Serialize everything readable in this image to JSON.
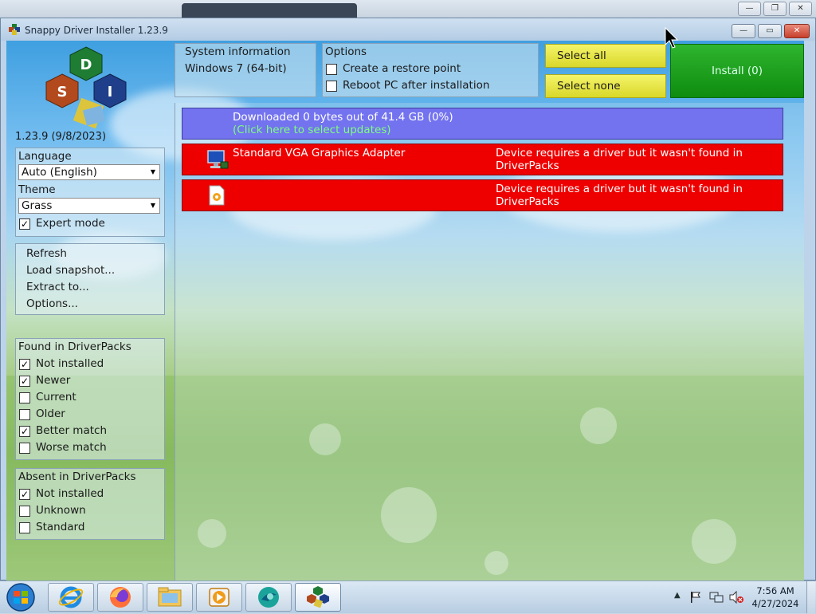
{
  "window": {
    "title": "Snappy Driver Installer 1.23.9",
    "controls": [
      "—",
      "▭",
      "✕"
    ]
  },
  "logo": {
    "letters": [
      "D",
      "S",
      "I"
    ],
    "version": "1.23.9 (9/8/2023)"
  },
  "sidebar": {
    "language_label": "Language",
    "language_value": "Auto (English)",
    "theme_label": "Theme",
    "theme_value": "Grass",
    "expert_mode_label": "Expert mode",
    "expert_mode_checked": true,
    "menu": [
      "Refresh",
      "Load snapshot...",
      "Extract to...",
      "Options..."
    ],
    "found_group": {
      "title": "Found in DriverPacks",
      "items": [
        {
          "label": "Not installed",
          "checked": true
        },
        {
          "label": "Newer",
          "checked": true
        },
        {
          "label": "Current",
          "checked": false
        },
        {
          "label": "Older",
          "checked": false
        },
        {
          "label": "Better match",
          "checked": true
        },
        {
          "label": "Worse match",
          "checked": false
        }
      ]
    },
    "absent_group": {
      "title": "Absent in DriverPacks",
      "items": [
        {
          "label": "Not installed",
          "checked": true
        },
        {
          "label": "Unknown",
          "checked": false
        },
        {
          "label": "Standard",
          "checked": false
        }
      ]
    }
  },
  "system_info": {
    "title": "System information",
    "os": "Windows 7 (64-bit)"
  },
  "options": {
    "title": "Options",
    "restore_point": "Create a restore point",
    "reboot": "Reboot PC after installation"
  },
  "buttons": {
    "select_all": "Select all",
    "select_none": "Select none",
    "install": "Install (0)"
  },
  "list": {
    "download": {
      "line1": "Downloaded 0 bytes out of 41.4 GB (0%)",
      "line2": "(Click here to select updates)"
    },
    "devices": [
      {
        "name": "Standard VGA Graphics Adapter",
        "status": "Device requires a driver but it wasn't found in DriverPacks",
        "icon": "monitor-icon"
      },
      {
        "name": "",
        "status": "Device requires a driver but it wasn't found in DriverPacks",
        "icon": "unknown-device-icon"
      }
    ]
  },
  "taskbar": {
    "time": "7:56 AM",
    "date": "4/27/2024",
    "apps": [
      "internet-explorer-icon",
      "firefox-icon",
      "file-explorer-icon",
      "media-player-icon",
      "browser-icon",
      "snappy-driver-installer-icon"
    ]
  },
  "colors": {
    "red_item": "#ee0000",
    "blue_item": "#7373f0",
    "link_green": "#7dff7d",
    "install_green": "#1a9e1a",
    "select_yellow": "#e6e63a"
  }
}
